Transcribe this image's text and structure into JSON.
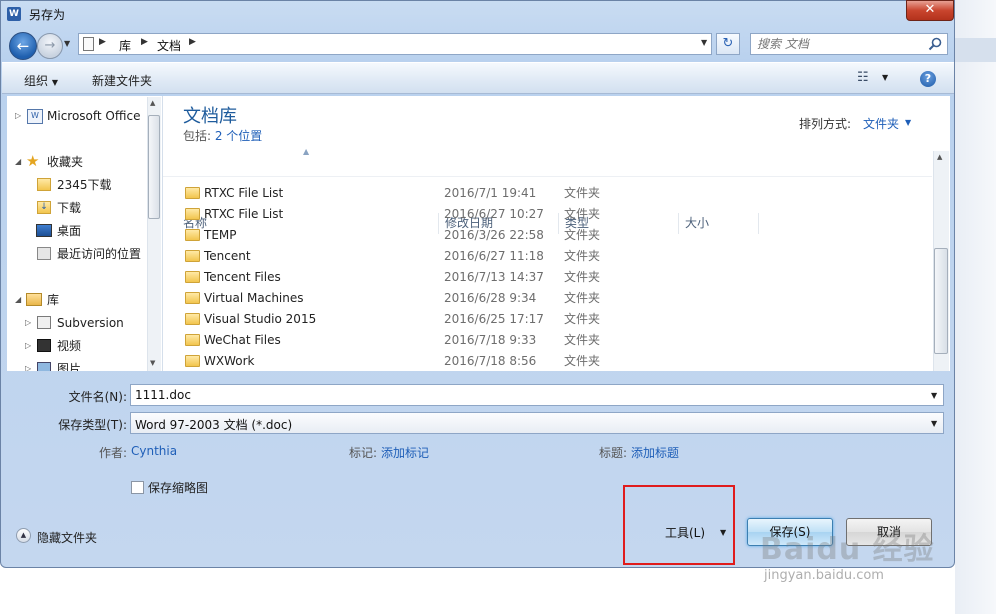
{
  "window": {
    "title": "另存为",
    "app_icon": "W"
  },
  "nav": {
    "back_icon": "back-arrow-icon",
    "forward_icon": "forward-arrow-icon"
  },
  "address": {
    "crumbs": [
      "库",
      "文档"
    ]
  },
  "search": {
    "placeholder": "搜索 文档"
  },
  "toolbar": {
    "organize": "组织",
    "new_folder": "新建文件夹",
    "help": "?"
  },
  "navpane": {
    "items": [
      {
        "label": "Microsoft Office",
        "icon": "word-icon",
        "arrow": "▷"
      },
      {
        "label": "收藏夹",
        "icon": "star-icon",
        "arrow": "◢"
      },
      {
        "label": "2345下载",
        "icon": "folder-icon",
        "arrow": ""
      },
      {
        "label": "下载",
        "icon": "download-folder-icon",
        "arrow": ""
      },
      {
        "label": "桌面",
        "icon": "desktop-icon",
        "arrow": ""
      },
      {
        "label": "最近访问的位置",
        "icon": "recent-places-icon",
        "arrow": ""
      },
      {
        "label": "库",
        "icon": "library-icon",
        "arrow": "◢"
      },
      {
        "label": "Subversion",
        "icon": "subversion-library-icon",
        "arrow": "▷"
      },
      {
        "label": "视频",
        "icon": "video-library-icon",
        "arrow": "▷"
      },
      {
        "label": "图片",
        "icon": "picture-library-icon",
        "arrow": "▷"
      }
    ]
  },
  "library": {
    "title": "文档库",
    "includes_prefix": "包括: ",
    "includes_link": "2 个位置",
    "sort_label": "排列方式:",
    "sort_value": "文件夹"
  },
  "columns": {
    "name": "名称",
    "date": "修改日期",
    "type": "类型",
    "size": "大小"
  },
  "files": [
    {
      "name": "RTXC File List",
      "date": "2016/7/1 19:41",
      "type": "文件夹"
    },
    {
      "name": "RTXC File List",
      "date": "2016/6/27 10:27",
      "type": "文件夹"
    },
    {
      "name": "TEMP",
      "date": "2016/3/26 22:58",
      "type": "文件夹"
    },
    {
      "name": "Tencent",
      "date": "2016/6/27 11:18",
      "type": "文件夹"
    },
    {
      "name": "Tencent Files",
      "date": "2016/7/13 14:37",
      "type": "文件夹"
    },
    {
      "name": "Virtual Machines",
      "date": "2016/6/28 9:34",
      "type": "文件夹"
    },
    {
      "name": "Visual Studio 2015",
      "date": "2016/6/25 17:17",
      "type": "文件夹"
    },
    {
      "name": "WeChat Files",
      "date": "2016/7/18 9:33",
      "type": "文件夹"
    },
    {
      "name": "WXWork",
      "date": "2016/7/18 8:56",
      "type": "文件夹"
    }
  ],
  "form": {
    "filename_label": "文件名(N):",
    "filename_value": "1111.doc",
    "type_label": "保存类型(T):",
    "type_value": "Word 97-2003 文档 (*.doc)",
    "author_label": "作者:",
    "author_value": "Cynthia",
    "tags_label": "标记:",
    "tags_value": "添加标记",
    "title_label": "标题:",
    "title_value": "添加标题",
    "thumbnail_label": "保存缩略图"
  },
  "footer": {
    "hide_folders": "隐藏文件夹",
    "tools": "工具(L)",
    "save": "保存(S)",
    "cancel": "取消"
  },
  "watermark": {
    "text": "Baidu 经验",
    "url": "jingyan.baidu.com"
  },
  "colors": {
    "link": "#1f5fb8",
    "highlight": "#e01c1c",
    "lib_title": "#1e5b9c"
  }
}
